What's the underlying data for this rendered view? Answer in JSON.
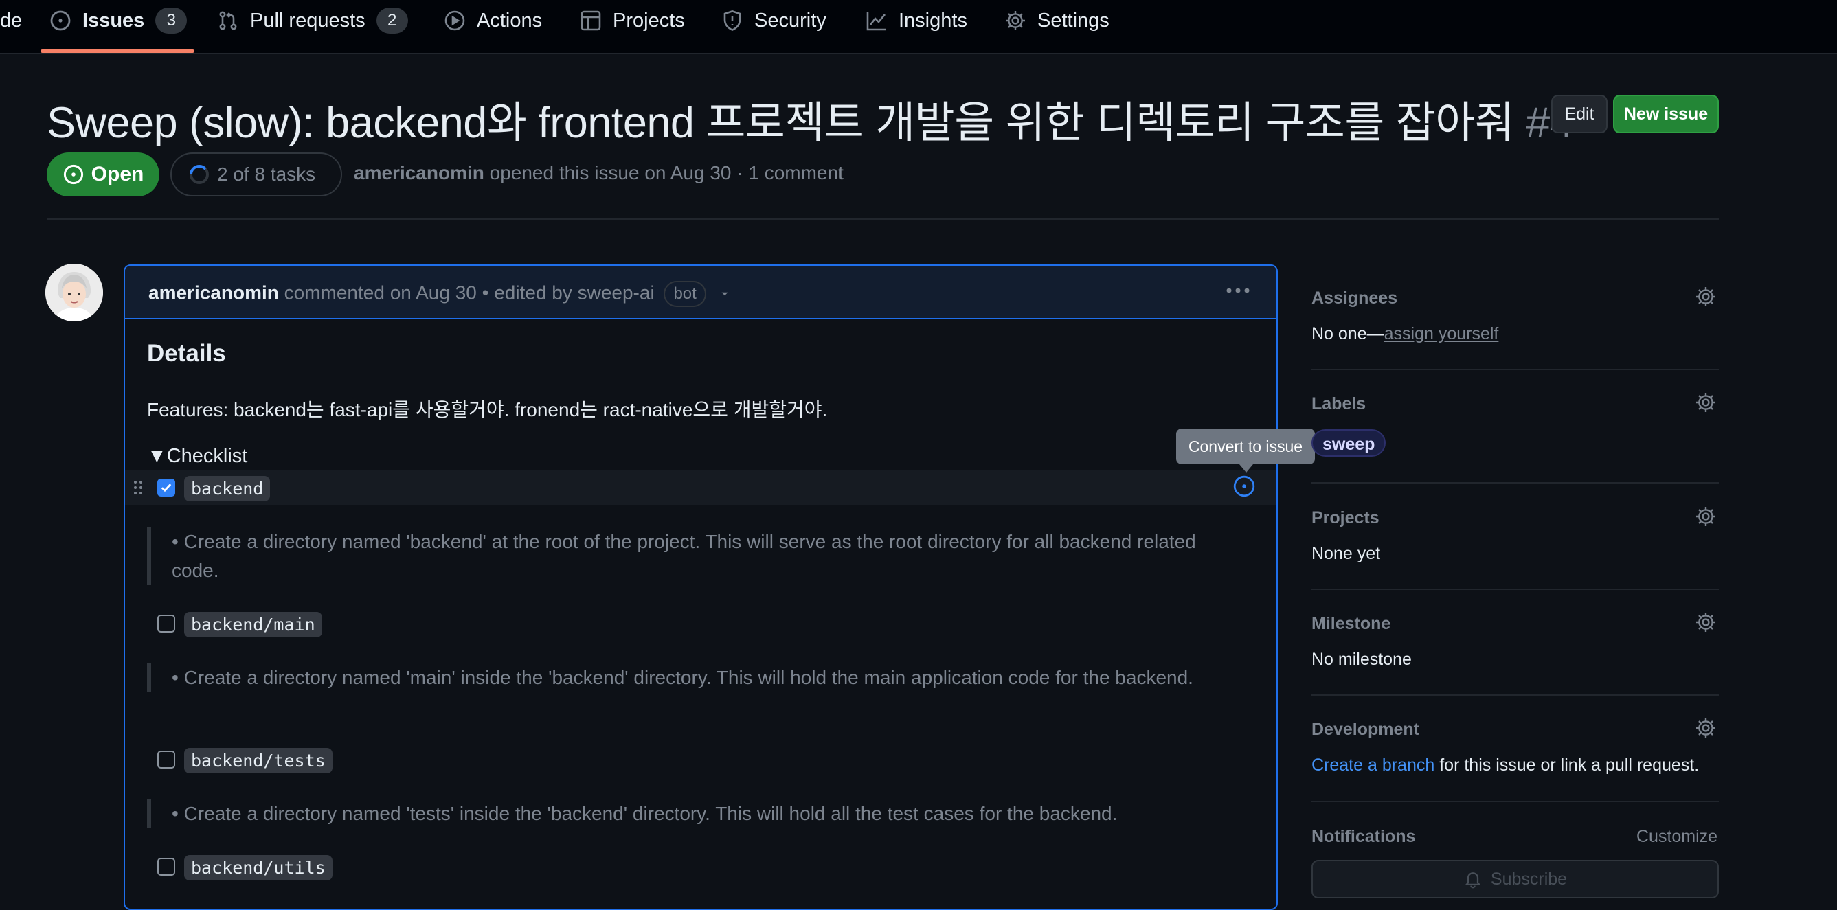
{
  "nav": {
    "partial_left": "de",
    "issues_label": "Issues",
    "issues_count": "3",
    "pulls_label": "Pull requests",
    "pulls_count": "2",
    "actions_label": "Actions",
    "projects_label": "Projects",
    "security_label": "Security",
    "insights_label": "Insights",
    "settings_label": "Settings"
  },
  "issue": {
    "title": "Sweep (slow): backend와 frontend 프로젝트 개발을 위한 디렉토리 구조를 잡아줘",
    "number": "#4",
    "edit_label": "Edit",
    "new_issue_label": "New issue",
    "state": "Open",
    "tasks": "2 of 8 tasks",
    "author": "americanomin",
    "opened_text": "opened this issue on Aug 30 · 1 comment"
  },
  "comment": {
    "author": "americanomin",
    "meta": "commented on Aug 30 • edited by sweep-ai",
    "bot": "bot",
    "heading": "Details",
    "features": "Features: backend는 fast-api를 사용할거야. fronend는 ract-native으로 개발할거야.",
    "checklist_summary": "▼Checklist",
    "tooltip": "Convert to issue",
    "items": [
      {
        "label": "backend",
        "checked": true,
        "desc": "• Create a directory named 'backend' at the root of the project. This will serve as the root directory for all backend related code."
      },
      {
        "label": "backend/main",
        "checked": false,
        "desc": "• Create a directory named 'main' inside the 'backend' directory. This will hold the main application code for the backend."
      },
      {
        "label": "backend/tests",
        "checked": false,
        "desc": "• Create a directory named 'tests' inside the 'backend' directory. This will hold all the test cases for the backend."
      },
      {
        "label": "backend/utils",
        "checked": false,
        "desc": ""
      }
    ]
  },
  "sidebar": {
    "assignees_title": "Assignees",
    "assignees_value": "No one—",
    "assign_yourself": "assign yourself",
    "labels_title": "Labels",
    "label_sweep": "sweep",
    "projects_title": "Projects",
    "projects_value": "None yet",
    "milestone_title": "Milestone",
    "milestone_value": "No milestone",
    "development_title": "Development",
    "create_branch": "Create a branch",
    "development_rest": " for this issue or link a pull request.",
    "notifications_title": "Notifications",
    "customize": "Customize",
    "subscribe": "Subscribe"
  },
  "colors": {
    "bg": "#0d1117",
    "accent_green": "#238636",
    "accent_blue": "#2f81f7",
    "nav_underline": "#f78166",
    "label_sweep_bg": "#1a1f45"
  },
  "icons": [
    "issue-opened-icon",
    "pull-request-icon",
    "play-icon",
    "table-icon",
    "shield-icon",
    "graph-icon",
    "gear-icon",
    "kebab-icon",
    "drag-handle-icon",
    "bell-icon"
  ]
}
